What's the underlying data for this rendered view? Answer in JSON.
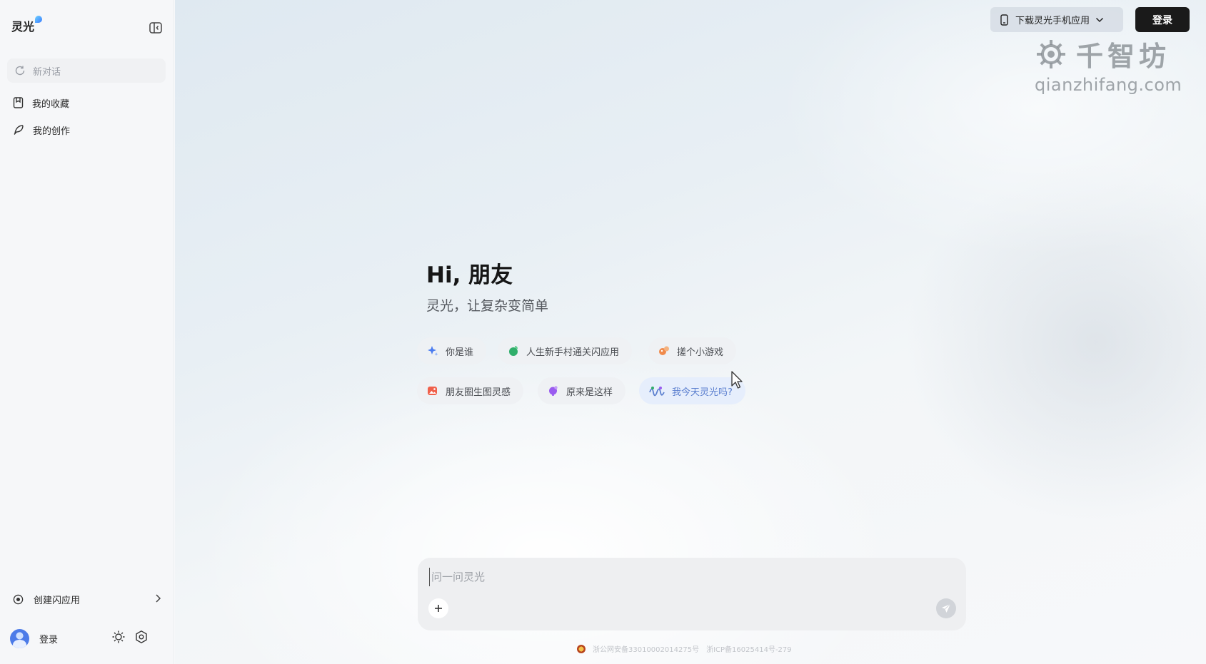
{
  "sidebar": {
    "logo_text": "灵光",
    "new_chat": "新对话",
    "items": [
      {
        "label": "我的收藏"
      },
      {
        "label": "我的创作"
      }
    ],
    "create_app": "创建闪应用",
    "user_label": "登录"
  },
  "header": {
    "download_label": "下载灵光手机应用",
    "login_label": "登录"
  },
  "watermark": {
    "brand": "千智坊",
    "url": "qianzhifang.com"
  },
  "main": {
    "greeting": "Hi, 朋友",
    "subtitle": "灵光，让复杂变简单",
    "suggestions": [
      {
        "label": "你是谁",
        "icon": "sparkle-icon",
        "color": "#4a7cf0"
      },
      {
        "label": "人生新手村通关闪应用",
        "icon": "leaf-icon",
        "color": "#2fae6a"
      },
      {
        "label": "搓个小游戏",
        "icon": "game-icon",
        "color": "#f08a4b"
      },
      {
        "label": "朋友圈生图灵感",
        "icon": "image-icon",
        "color": "#f0604b"
      },
      {
        "label": "原来是这样",
        "icon": "bulb-icon",
        "color": "#9a5cf0"
      },
      {
        "label": "我今天灵光吗?",
        "icon": "wave-icon",
        "color": "#5b7fcf"
      }
    ]
  },
  "input": {
    "placeholder": "问一问灵光"
  },
  "footer": {
    "police_record": "浙公网安备33010002014275号",
    "icp_record": "浙ICP备16025414号-279"
  }
}
